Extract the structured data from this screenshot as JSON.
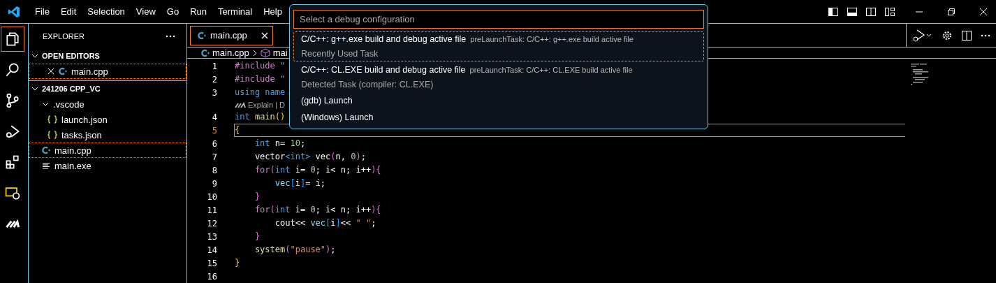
{
  "menu_bar": {
    "items": [
      "File",
      "Edit",
      "Selection",
      "View",
      "Go",
      "Run",
      "Terminal",
      "Help"
    ]
  },
  "activity_bar": {
    "items": [
      {
        "kind": "explorer",
        "selected": true
      },
      {
        "kind": "search",
        "selected": false
      },
      {
        "kind": "source-control",
        "selected": false
      },
      {
        "kind": "run-debug",
        "selected": false
      },
      {
        "kind": "extensions",
        "selected": false
      },
      {
        "kind": "remote",
        "selected": false
      },
      {
        "kind": "assistant",
        "selected": false
      }
    ]
  },
  "sidebar": {
    "title": "EXPLORER",
    "open_editors": {
      "title": "OPEN EDITORS",
      "expanded": true,
      "items": [
        {
          "label": "main.cpp",
          "kind": "cpp",
          "selected": true
        }
      ]
    },
    "folder": {
      "title": "241206 CPP_VC",
      "expanded": true,
      "items": [
        {
          "label": ".vscode",
          "kind": "folder",
          "expanded": true,
          "selected": false,
          "children": [
            {
              "label": "launch.json",
              "kind": "json",
              "selected": false
            },
            {
              "label": "tasks.json",
              "kind": "json",
              "selected": false
            }
          ]
        },
        {
          "label": "main.cpp",
          "kind": "cpp",
          "selected": true
        },
        {
          "label": "main.exe",
          "kind": "file",
          "selected": false
        }
      ]
    }
  },
  "editor": {
    "tabs": [
      {
        "label": "main.cpp",
        "selected": true
      }
    ],
    "breadcrumb": [
      {
        "label": "main.cpp",
        "kind": "cpp"
      },
      {
        "label": "mai",
        "kind": "symbol"
      }
    ],
    "lines": [
      {
        "number": "1",
        "current": false,
        "tokens": [
          {
            "t": "#include \"",
            "kind": "preproc"
          }
        ]
      },
      {
        "number": "2",
        "current": false,
        "tokens": [
          {
            "t": "#include \"",
            "kind": "preproc"
          }
        ]
      },
      {
        "number": "3",
        "current": false,
        "tokens": [
          {
            "t": "using",
            "kind": "keyword"
          },
          {
            "t": " name",
            "kind": "keyword"
          }
        ],
        "codelens": "Explain | D"
      },
      {
        "number": "4",
        "current": false,
        "tokens": [
          {
            "t": "int",
            "kind": "keyword"
          },
          {
            "t": " main",
            "kind": "func"
          },
          {
            "t": "()",
            "kind": "bracket1"
          }
        ]
      },
      {
        "number": "5",
        "current": true,
        "tokens": [
          {
            "t": "{",
            "kind": "bracket1"
          }
        ]
      },
      {
        "number": "6",
        "current": false,
        "tokens": [
          {
            "t": "    int",
            "kind": "keyword"
          },
          {
            "t": " n= ",
            "kind": "plain"
          },
          {
            "t": "10",
            "kind": "number"
          },
          {
            "t": ";",
            "kind": "plain"
          }
        ]
      },
      {
        "number": "7",
        "current": false,
        "tokens": [
          {
            "t": "    vector",
            "kind": "plain"
          },
          {
            "t": "<int>",
            "kind": "keyword"
          },
          {
            "t": " vec",
            "kind": "plain"
          },
          {
            "t": "(",
            "kind": "bracket2"
          },
          {
            "t": "n, ",
            "kind": "plain"
          },
          {
            "t": "0",
            "kind": "number"
          },
          {
            "t": ")",
            "kind": "bracket2"
          },
          {
            "t": ";",
            "kind": "plain"
          }
        ]
      },
      {
        "number": "8",
        "current": false,
        "tokens": [
          {
            "t": "    for",
            "kind": "control"
          },
          {
            "t": "(",
            "kind": "bracket2"
          },
          {
            "t": "int",
            "kind": "keyword"
          },
          {
            "t": " i= ",
            "kind": "plain"
          },
          {
            "t": "0",
            "kind": "number"
          },
          {
            "t": "; i< n; i++",
            "kind": "plain"
          },
          {
            "t": "){",
            "kind": "bracket2"
          }
        ]
      },
      {
        "number": "9",
        "current": false,
        "tokens": [
          {
            "t": "        vec",
            "kind": "variable"
          },
          {
            "t": "[",
            "kind": "bracket3"
          },
          {
            "t": "i",
            "kind": "plain"
          },
          {
            "t": "]",
            "kind": "bracket3"
          },
          {
            "t": "= i;",
            "kind": "plain"
          }
        ]
      },
      {
        "number": "10",
        "current": false,
        "tokens": [
          {
            "t": "    }",
            "kind": "bracket2"
          }
        ]
      },
      {
        "number": "11",
        "current": false,
        "tokens": [
          {
            "t": "    for",
            "kind": "control"
          },
          {
            "t": "(",
            "kind": "bracket2"
          },
          {
            "t": "int",
            "kind": "keyword"
          },
          {
            "t": " i= ",
            "kind": "plain"
          },
          {
            "t": "0",
            "kind": "number"
          },
          {
            "t": "; i< n; i++",
            "kind": "plain"
          },
          {
            "t": "){",
            "kind": "bracket2"
          }
        ]
      },
      {
        "number": "12",
        "current": false,
        "tokens": [
          {
            "t": "        cout<< ",
            "kind": "plain"
          },
          {
            "t": "vec",
            "kind": "variable"
          },
          {
            "t": "[",
            "kind": "bracket3"
          },
          {
            "t": "i",
            "kind": "plain"
          },
          {
            "t": "]",
            "kind": "bracket3"
          },
          {
            "t": "<< ",
            "kind": "plain"
          },
          {
            "t": "\" \"",
            "kind": "string"
          },
          {
            "t": ";",
            "kind": "plain"
          }
        ]
      },
      {
        "number": "13",
        "current": false,
        "tokens": [
          {
            "t": "    }",
            "kind": "bracket2"
          }
        ]
      },
      {
        "number": "14",
        "current": false,
        "tokens": [
          {
            "t": "    system",
            "kind": "func"
          },
          {
            "t": "(",
            "kind": "bracket2"
          },
          {
            "t": "\"pause\"",
            "kind": "string"
          },
          {
            "t": ")",
            "kind": "bracket2"
          },
          {
            "t": ";",
            "kind": "plain"
          }
        ]
      },
      {
        "number": "15",
        "current": false,
        "tokens": [
          {
            "t": "}",
            "kind": "bracket1"
          }
        ]
      },
      {
        "number": "16",
        "current": false
      }
    ]
  },
  "quick_pick": {
    "placeholder": "Select a debug configuration",
    "items": [
      {
        "label": "C/C++: g++.exe build and debug active file",
        "description": "preLaunchTask: C/C++: g++.exe build active file",
        "detail": "Recently Used Task",
        "selected": true
      },
      {
        "label": "C/C++: CL.EXE build and debug active file",
        "description": "preLaunchTask: C/C++: CL.EXE build active file",
        "detail": "Detected Task (compiler: CL.EXE)",
        "selected": false
      },
      {
        "label": "(gdb) Launch",
        "selected": false
      },
      {
        "label": "(Windows) Launch",
        "selected": false
      }
    ]
  }
}
